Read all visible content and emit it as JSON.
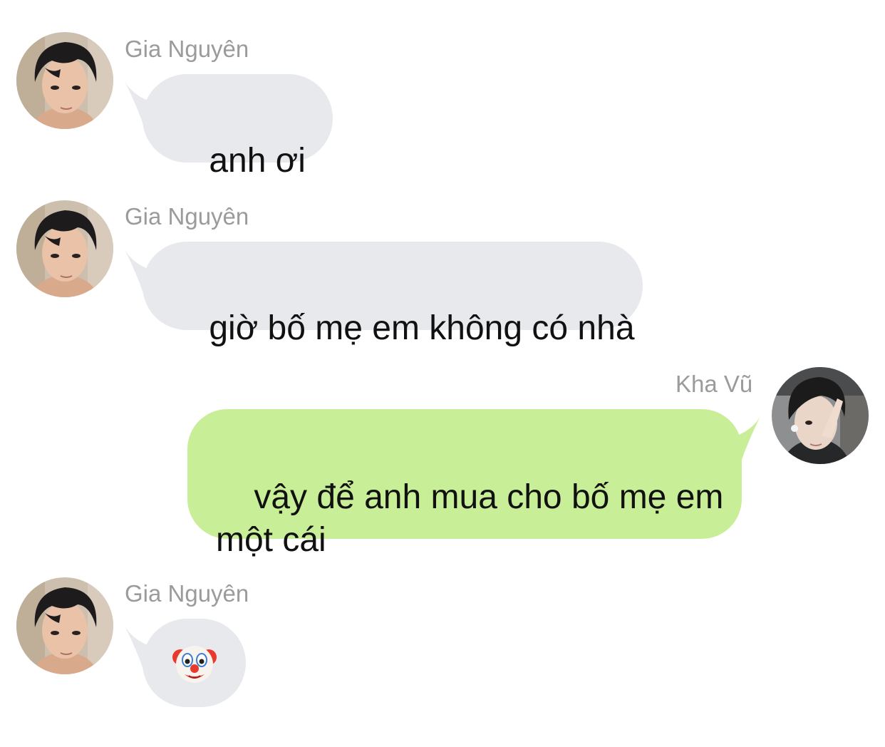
{
  "conversation": {
    "messages": [
      {
        "sender": "Gia Nguyên",
        "side": "left",
        "text": "anh ơi",
        "avatar_icon": "avatar-gia-nguyen"
      },
      {
        "sender": "Gia Nguyên",
        "side": "left",
        "text": "giờ bố mẹ em không có nhà",
        "avatar_icon": "avatar-gia-nguyen"
      },
      {
        "sender": "Kha Vũ",
        "side": "right",
        "text": "vậy để anh mua cho bố mẹ em\nmột cái",
        "avatar_icon": "avatar-kha-vu"
      },
      {
        "sender": "Gia Nguyên",
        "side": "left",
        "text": "",
        "emoji_icon": "clown-face-icon",
        "avatar_icon": "avatar-gia-nguyen"
      }
    ]
  },
  "colors": {
    "incoming_bubble": "#e7e9ec",
    "outgoing_bubble": "#c9ee98",
    "sender_name": "#9b9b9b",
    "message_text": "#111111",
    "background": "#ffffff"
  }
}
